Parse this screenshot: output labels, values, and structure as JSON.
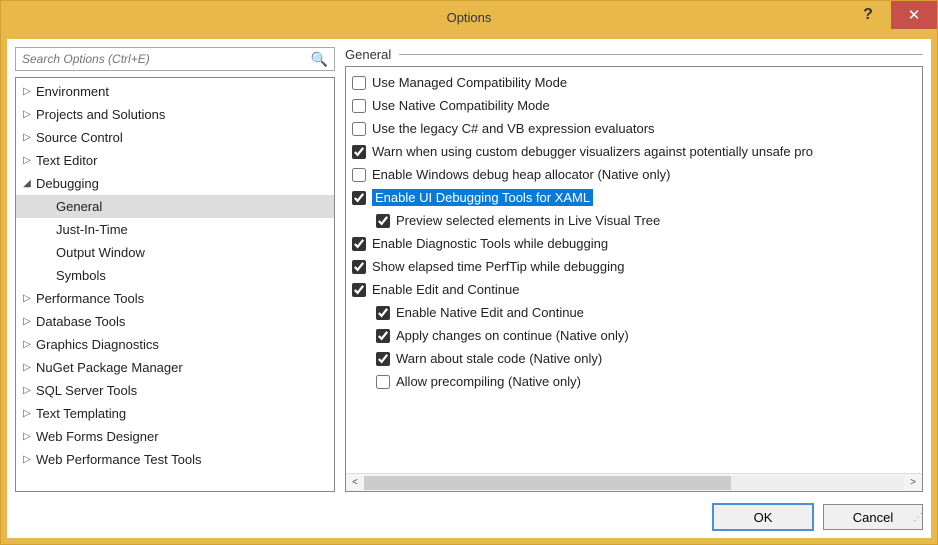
{
  "window": {
    "title": "Options"
  },
  "search": {
    "placeholder": "Search Options (Ctrl+E)"
  },
  "tree": {
    "items": [
      {
        "label": "Environment",
        "expanded": false,
        "level": 0
      },
      {
        "label": "Projects and Solutions",
        "expanded": false,
        "level": 0
      },
      {
        "label": "Source Control",
        "expanded": false,
        "level": 0
      },
      {
        "label": "Text Editor",
        "expanded": false,
        "level": 0
      },
      {
        "label": "Debugging",
        "expanded": true,
        "level": 0
      },
      {
        "label": "General",
        "level": 1,
        "selected": true
      },
      {
        "label": "Just-In-Time",
        "level": 1
      },
      {
        "label": "Output Window",
        "level": 1
      },
      {
        "label": "Symbols",
        "level": 1
      },
      {
        "label": "Performance Tools",
        "expanded": false,
        "level": 0
      },
      {
        "label": "Database Tools",
        "expanded": false,
        "level": 0
      },
      {
        "label": "Graphics Diagnostics",
        "expanded": false,
        "level": 0
      },
      {
        "label": "NuGet Package Manager",
        "expanded": false,
        "level": 0
      },
      {
        "label": "SQL Server Tools",
        "expanded": false,
        "level": 0
      },
      {
        "label": "Text Templating",
        "expanded": false,
        "level": 0
      },
      {
        "label": "Web Forms Designer",
        "expanded": false,
        "level": 0
      },
      {
        "label": "Web Performance Test Tools",
        "expanded": false,
        "level": 0
      }
    ]
  },
  "section": {
    "title": "General"
  },
  "options": [
    {
      "label": "Use Managed Compatibility Mode",
      "checked": false,
      "indent": 0
    },
    {
      "label": "Use Native Compatibility Mode",
      "checked": false,
      "indent": 0
    },
    {
      "label": "Use the legacy C# and VB expression evaluators",
      "checked": false,
      "indent": 0
    },
    {
      "label": "Warn when using custom debugger visualizers against potentially unsafe pro",
      "checked": true,
      "indent": 0
    },
    {
      "label": "Enable Windows debug heap allocator (Native only)",
      "checked": false,
      "indent": 0
    },
    {
      "label": "Enable UI Debugging Tools for XAML",
      "checked": true,
      "indent": 0,
      "highlighted": true
    },
    {
      "label": "Preview selected elements in Live Visual Tree",
      "checked": true,
      "indent": 1
    },
    {
      "label": "Enable Diagnostic Tools while debugging",
      "checked": true,
      "indent": 0
    },
    {
      "label": "Show elapsed time PerfTip while debugging",
      "checked": true,
      "indent": 0
    },
    {
      "label": "Enable Edit and Continue",
      "checked": true,
      "indent": 0
    },
    {
      "label": "Enable Native Edit and Continue",
      "checked": true,
      "indent": 1
    },
    {
      "label": "Apply changes on continue (Native only)",
      "checked": true,
      "indent": 1
    },
    {
      "label": "Warn about stale code (Native only)",
      "checked": true,
      "indent": 1
    },
    {
      "label": "Allow precompiling (Native only)",
      "checked": false,
      "indent": 1
    }
  ],
  "buttons": {
    "ok": "OK",
    "cancel": "Cancel"
  }
}
